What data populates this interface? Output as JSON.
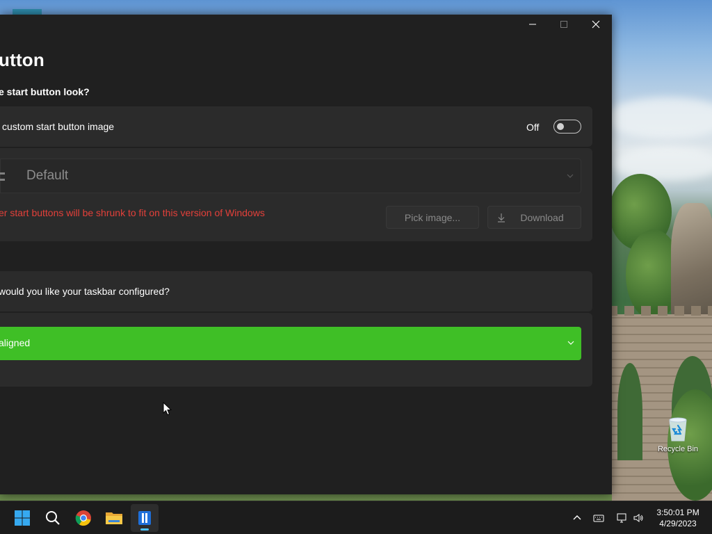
{
  "window": {
    "page_title": "utton",
    "section_heading": "e start button look?",
    "custom_image_label": "custom start button image",
    "toggle_state": "Off",
    "style_selected": "Default",
    "warning_text": "er start buttons will be shrunk to fit on this version of Windows",
    "pick_image_label": "Pick image...",
    "download_label": "Download",
    "taskbar_question": "would you like your taskbar configured?",
    "taskbar_alignment": "aligned"
  },
  "desktop": {
    "recycle_bin_label": "Recycle Bin"
  },
  "taskbar": {
    "time": "3:50:01 PM",
    "date": "4/29/2023"
  },
  "colors": {
    "accent_green": "#3fbf26",
    "warning_red": "#e3403a",
    "window_bg": "#202020",
    "card_bg": "#2b2b2b",
    "taskbar_bg": "#1c1c1c"
  },
  "icons": [
    "minimize-icon",
    "maximize-icon",
    "close-icon",
    "start-thumbnail-icon",
    "chevron-down-icon",
    "download-icon",
    "windows-start-icon",
    "search-icon",
    "chrome-icon",
    "file-explorer-icon",
    "app-icon",
    "recycle-bin-icon",
    "chevron-up-icon",
    "keyboard-icon",
    "network-icon",
    "volume-icon",
    "mouse-cursor-icon"
  ]
}
